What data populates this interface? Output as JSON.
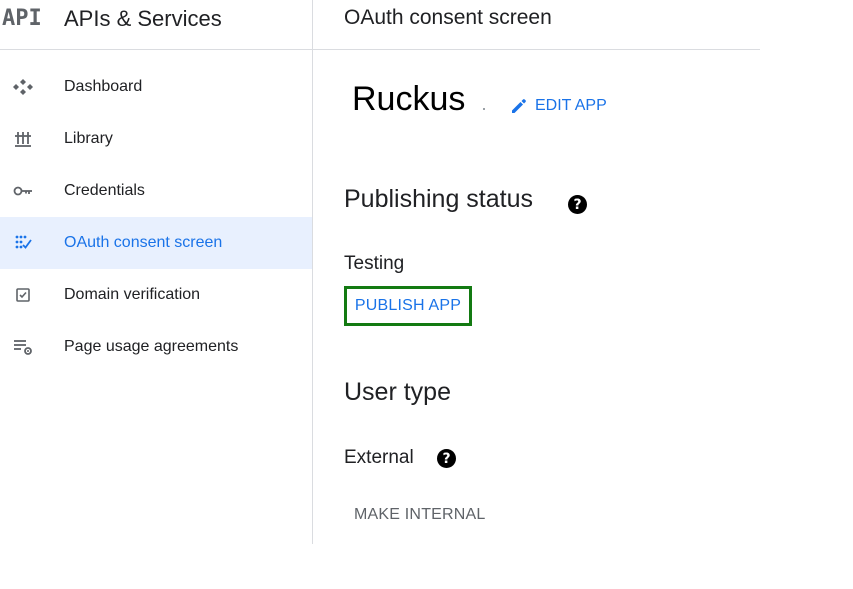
{
  "sidebar": {
    "logo": "API",
    "title": "APIs & Services",
    "items": [
      {
        "label": "Dashboard",
        "icon": "dashboard-icon",
        "active": false
      },
      {
        "label": "Library",
        "icon": "library-icon",
        "active": false
      },
      {
        "label": "Credentials",
        "icon": "key-icon",
        "active": false
      },
      {
        "label": "OAuth consent screen",
        "icon": "consent-icon",
        "active": true
      },
      {
        "label": "Domain verification",
        "icon": "checkbox-icon",
        "active": false
      },
      {
        "label": "Page usage agreements",
        "icon": "settings-list-icon",
        "active": false
      }
    ]
  },
  "header": {
    "title": "OAuth consent screen"
  },
  "app": {
    "name": "Ruckus",
    "edit_label": "EDIT APP"
  },
  "publishing": {
    "title": "Publishing status",
    "status": "Testing",
    "publish_label": "PUBLISH APP"
  },
  "user_type": {
    "title": "User type",
    "value": "External",
    "make_internal_label": "MAKE INTERNAL"
  },
  "colors": {
    "accent": "#1a73e8",
    "active_bg": "#e8f0fe",
    "highlight_border": "#137a12"
  }
}
